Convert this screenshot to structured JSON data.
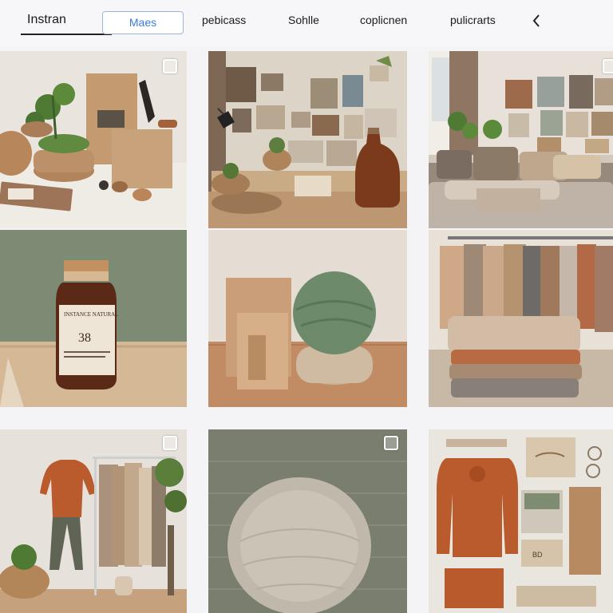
{
  "nav": {
    "logo": "Instran",
    "tabs": [
      {
        "label": "Maes",
        "active": true
      },
      {
        "label": "pebicass"
      },
      {
        "label": "Sohlle"
      },
      {
        "label": "coplicnen"
      },
      {
        "label": "pulicrarts"
      }
    ],
    "back_icon": "chevron-left-icon"
  },
  "grid": {
    "tiles": [
      {
        "subject": "plants-kraft-boxes"
      },
      {
        "subject": "gallery-wall-amber-jar"
      },
      {
        "subject": "living-room-sofa"
      },
      {
        "subject": "amber-bottle"
      },
      {
        "subject": "kraft-box-yarn-ball"
      },
      {
        "subject": "clothes-rack-folded-knits"
      },
      {
        "subject": "sweater-clothing-rack"
      },
      {
        "subject": "knit-pouf"
      },
      {
        "subject": "flatlay-cardigan-tags"
      }
    ],
    "bottle_label_number": "38",
    "tag_text": "BD"
  },
  "colors": {
    "accent": "#3a7bd5",
    "rust": "#b8592b",
    "kraft": "#c39a72",
    "sage": "#7d8a74"
  }
}
